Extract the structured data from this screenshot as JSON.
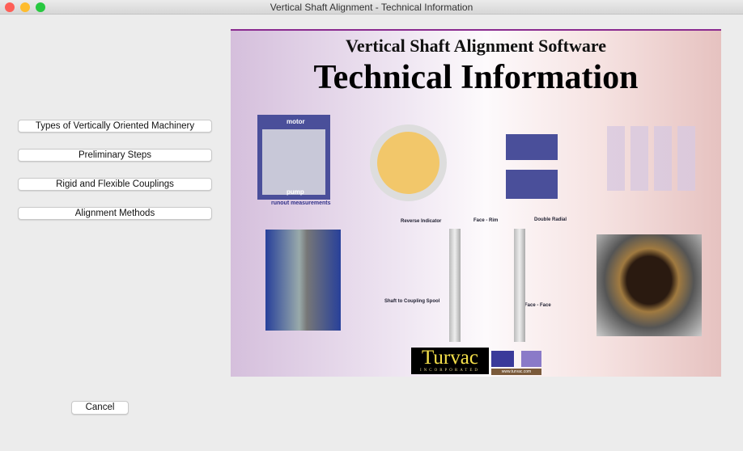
{
  "window": {
    "title": "Vertical Shaft Alignment - Technical Information"
  },
  "menu": [
    {
      "label": "Types of Vertically Oriented Machinery"
    },
    {
      "label": "Preliminary Steps"
    },
    {
      "label": "Rigid and Flexible Couplings"
    },
    {
      "label": "Alignment Methods"
    }
  ],
  "cancel_label": "Cancel",
  "banner": {
    "subtitle": "Vertical Shaft Alignment Software",
    "title": "Technical Information",
    "labels": {
      "motor": "motor",
      "pump": "pump",
      "runout": "runout measurements",
      "reverse": "Reverse Indicator",
      "face_rim": "Face - Rim",
      "double_radial": "Double Radial",
      "spool": "Shaft to Coupling Spool",
      "face_face": "Face - Face"
    },
    "logo": "Turvac",
    "logo_sub": "INCORPORATED",
    "url": "www.turvac.com"
  },
  "colors": {
    "accent": "#8a2a8f",
    "gold": "#f5e04a"
  }
}
